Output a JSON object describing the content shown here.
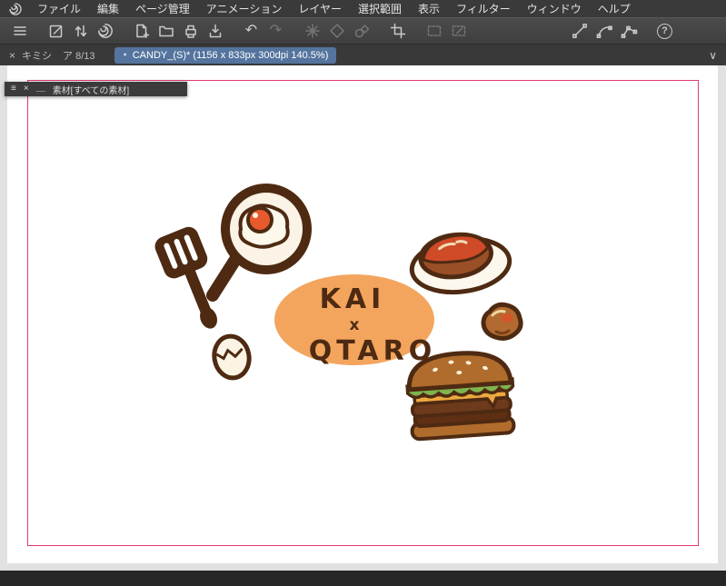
{
  "menubar": {
    "items": [
      "ファイル",
      "編集",
      "ページ管理",
      "アニメーション",
      "レイヤー",
      "選択範囲",
      "表示",
      "フィルター",
      "ウィンドウ",
      "ヘルプ"
    ]
  },
  "toolbar_icons": {
    "undo": "↶",
    "redo": "↷",
    "help": "?"
  },
  "tab_bar": {
    "inactive": {
      "close": "×",
      "label": "キミシ",
      "pages": "ア 8/13"
    },
    "active": {
      "dot": "●",
      "label": "CANDY_(S)* (1156 x 833px 300dpi 140.5%)"
    },
    "chevron": "∨"
  },
  "panel": {
    "menu": "≡",
    "close": "×",
    "minimize": "＿",
    "title": "素材[すべての素材]"
  },
  "artwork": {
    "line1": "KAI",
    "line2": "x",
    "line3": "QTARO"
  },
  "colors": {
    "active_tab": "#54749e",
    "trim_border": "#dd3a6e",
    "outline_brown": "#4e2a12",
    "oval_orange": "#f3a55e",
    "yolk_orange": "#e85a2e",
    "lettuce_green": "#7fb44e",
    "cheese_orange": "#eca93f",
    "bun_brown": "#b06c2c"
  }
}
